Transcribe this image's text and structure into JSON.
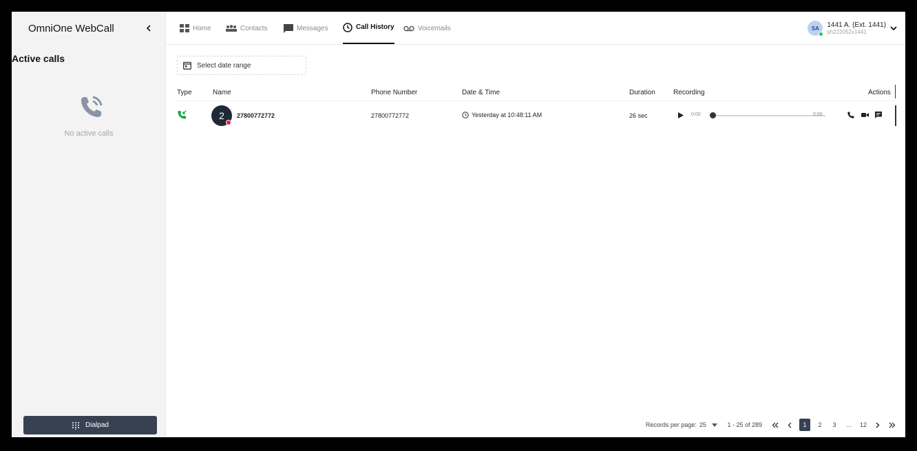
{
  "app": {
    "title": "OmniOne WebCall"
  },
  "sidebar": {
    "active_calls_title": "Active calls",
    "empty_text": "No active calls",
    "dialpad_label": "Dialpad"
  },
  "nav": {
    "tabs": [
      {
        "label": "Home",
        "icon": "grid-icon"
      },
      {
        "label": "Contacts",
        "icon": "contacts-icon"
      },
      {
        "label": "Messages",
        "icon": "message-icon"
      },
      {
        "label": "Call History",
        "icon": "clock-icon",
        "active": true
      },
      {
        "label": "Voicemails",
        "icon": "voicemail-icon"
      }
    ]
  },
  "user": {
    "initials": "SA",
    "name": "1441 A. (Ext. 1441)",
    "id": "ph222052x1441",
    "status_color": "#22c55e"
  },
  "filter": {
    "date_range_placeholder": "Select date range"
  },
  "table": {
    "columns": [
      "Type",
      "Name",
      "Phone Number",
      "Date & Time",
      "Duration",
      "Recording",
      "Actions"
    ],
    "rows": [
      {
        "type_icon": "incoming-call-icon",
        "avatar_text": "2",
        "name": "27800772772",
        "phone": "27800772772",
        "datetime": "Yesterday at 10:48:11 AM",
        "duration": "26 sec",
        "rec_current": "0:00",
        "rec_total": "0:00"
      }
    ]
  },
  "pagination": {
    "records_label": "Records per page:",
    "per_page": "25",
    "range": "1 - 25 of 289",
    "pages": [
      "1",
      "2",
      "3",
      "...",
      "12"
    ],
    "current_page": "1"
  },
  "colors": {
    "dialpad_bg": "#374151",
    "incoming_green": "#16a34a",
    "unread_red": "#e11d48"
  }
}
